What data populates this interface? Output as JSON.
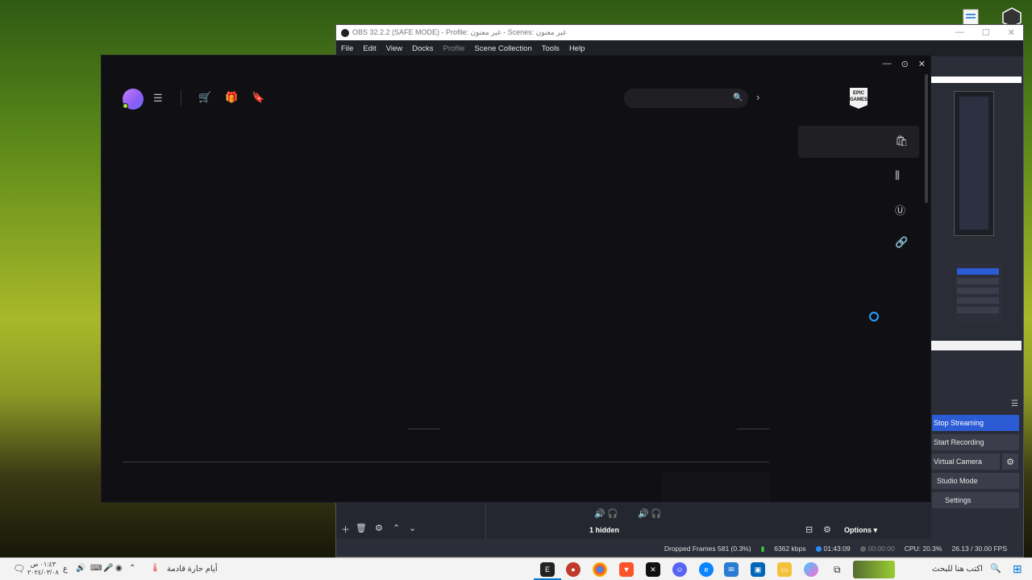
{
  "obs": {
    "title": "OBS 32.2.2 (SAFE MODE) - Profile: غير معنون - Scenes: غير معنون",
    "menu": [
      "File",
      "Edit",
      "View",
      "Docks",
      "Profile",
      "Scene Collection",
      "Tools",
      "Help"
    ],
    "controls": {
      "stop_streaming": "Stop Streaming",
      "start_recording": "Start Recording",
      "virtual_camera": "Virtual Camera",
      "studio_mode": "Studio Mode",
      "settings": "Settings"
    },
    "audio_hidden": "1 hidden",
    "options_label": "Options",
    "status": {
      "dropped_frames": "Dropped Frames 581 (0.3%)",
      "bitrate": "6362 kbps",
      "stream_time": "01:43:09",
      "record_time": "00:00:00",
      "cpu": "CPU: 20.3%",
      "fps": "26.13 / 30.00 FPS"
    }
  },
  "epic": {
    "search": {
      "value": "",
      "placeholder": ""
    },
    "logo_text": "EPIC GAMES",
    "sidebar_icons": [
      "store-icon",
      "library-icon",
      "unreal-icon",
      "link-icon"
    ],
    "loading": true
  },
  "taskbar": {
    "search_placeholder": "اكتب هنا للبحث",
    "weather": "أيام حارة قادمة",
    "clock_time": "٠١:٤٣ ص",
    "clock_date": "٢٠٢٤/٠٣/٠٨",
    "keyboard_lang": "ع"
  },
  "colors": {
    "accent_blue": "#2c5bd6",
    "epic_bg": "#101014",
    "spinner": "#26a0ff"
  }
}
